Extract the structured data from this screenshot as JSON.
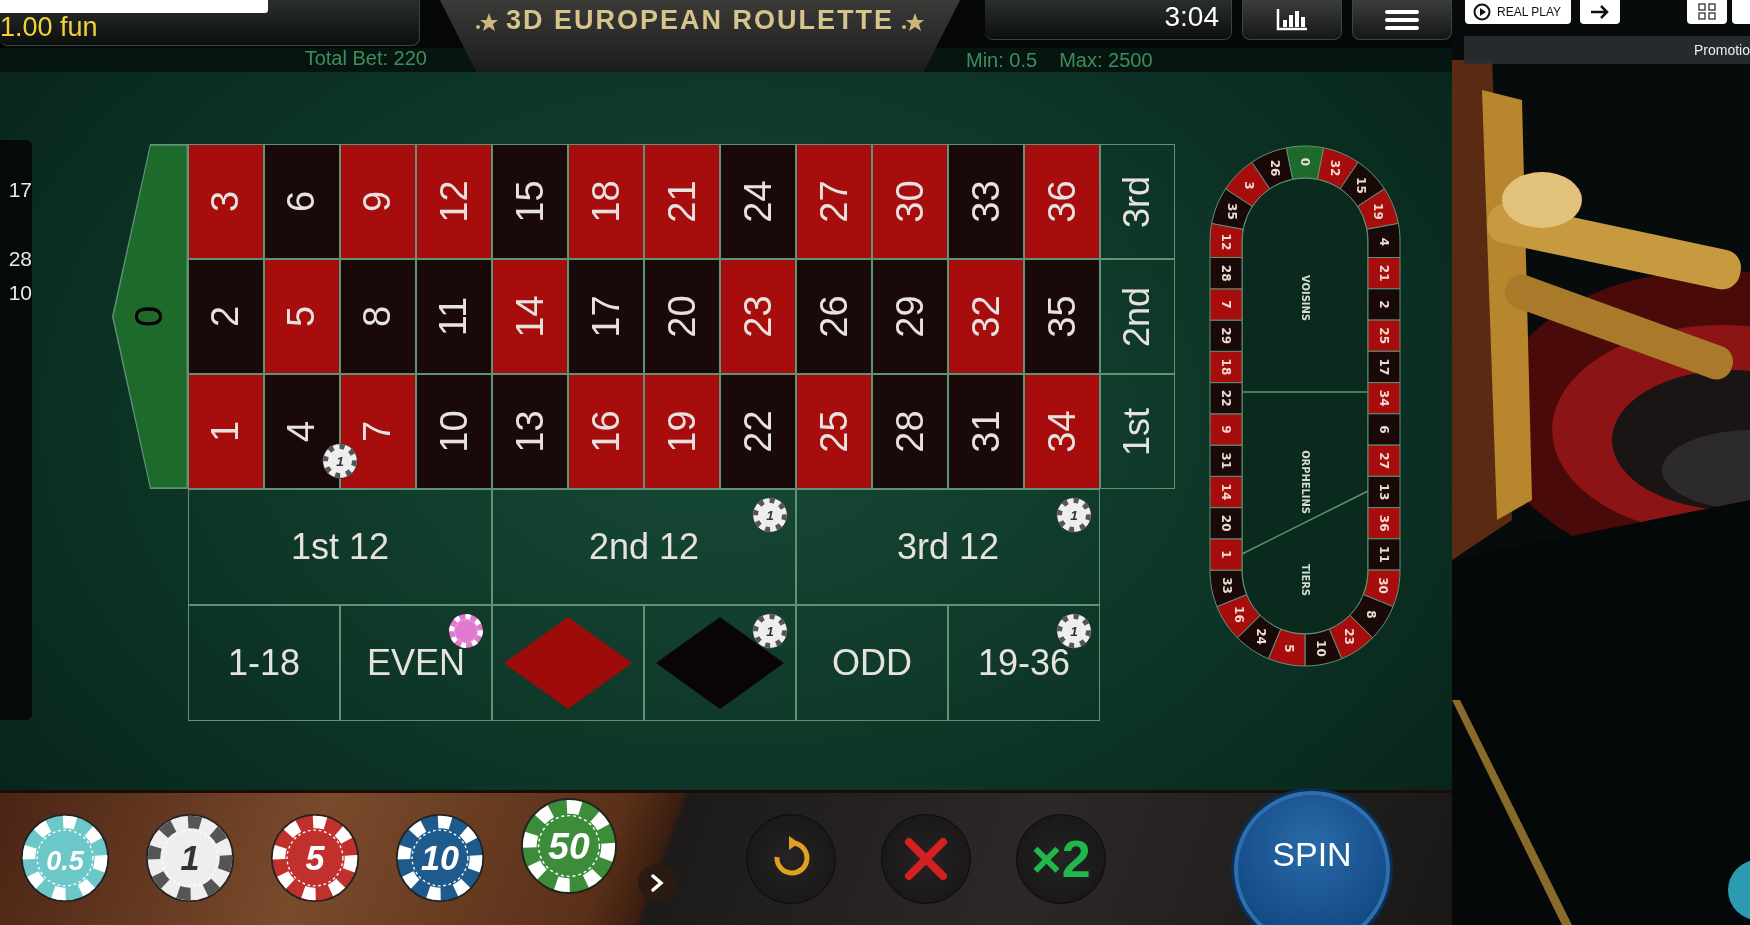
{
  "top_bar": {
    "balance": "1.00 fun",
    "title": "3D EUROPEAN ROULETTE",
    "timer": "3:04",
    "total_bet": "Total Bet: 220",
    "limits": [
      "Min: 0.5",
      "Max: 2500"
    ]
  },
  "history": [
    "17",
    "28",
    "10"
  ],
  "zero": {
    "label": "0",
    "color": "#1d6a2a"
  },
  "table": {
    "rows": [
      [
        {
          "label": "3",
          "color": "#a80d0d"
        },
        {
          "label": "6",
          "color": "#1a0909"
        },
        {
          "label": "9",
          "color": "#a80d0d"
        },
        {
          "label": "12",
          "color": "#a80d0d"
        },
        {
          "label": "15",
          "color": "#1a0909"
        },
        {
          "label": "18",
          "color": "#a80d0d"
        },
        {
          "label": "21",
          "color": "#a80d0d"
        },
        {
          "label": "24",
          "color": "#1a0909"
        },
        {
          "label": "27",
          "color": "#a80d0d"
        },
        {
          "label": "30",
          "color": "#a80d0d"
        },
        {
          "label": "33",
          "color": "#1a0909"
        },
        {
          "label": "36",
          "color": "#a80d0d"
        }
      ],
      [
        {
          "label": "2",
          "color": "#1a0909"
        },
        {
          "label": "5",
          "color": "#a80d0d"
        },
        {
          "label": "8",
          "color": "#1a0909"
        },
        {
          "label": "11",
          "color": "#1a0909"
        },
        {
          "label": "14",
          "color": "#a80d0d"
        },
        {
          "label": "17",
          "color": "#1a0909"
        },
        {
          "label": "20",
          "color": "#1a0909"
        },
        {
          "label": "23",
          "color": "#a80d0d"
        },
        {
          "label": "26",
          "color": "#1a0909"
        },
        {
          "label": "29",
          "color": "#1a0909"
        },
        {
          "label": "32",
          "color": "#a80d0d"
        },
        {
          "label": "35",
          "color": "#1a0909"
        }
      ],
      [
        {
          "label": "1",
          "color": "#a80d0d"
        },
        {
          "label": "4",
          "color": "#1a0909",
          "bet": {
            "color": "#eeeeee",
            "label": "1"
          }
        },
        {
          "label": "7",
          "color": "#a80d0d"
        },
        {
          "label": "10",
          "color": "#1a0909"
        },
        {
          "label": "13",
          "color": "#1a0909"
        },
        {
          "label": "16",
          "color": "#a80d0d"
        },
        {
          "label": "19",
          "color": "#a80d0d"
        },
        {
          "label": "22",
          "color": "#1a0909"
        },
        {
          "label": "25",
          "color": "#a80d0d"
        },
        {
          "label": "28",
          "color": "#1a0909"
        },
        {
          "label": "31",
          "color": "#1a0909"
        },
        {
          "label": "34",
          "color": "#a80d0d"
        }
      ]
    ],
    "column_bets": [
      "3rd",
      "2nd",
      "1st"
    ],
    "dozens": [
      {
        "label": "1st 12"
      },
      {
        "label": "2nd 12",
        "bet": {
          "color": "#eeeeee",
          "label": "1"
        }
      },
      {
        "label": "3rd 12",
        "bet": {
          "color": "#eeeeee",
          "label": "1"
        }
      }
    ],
    "outside": [
      {
        "kind": "text",
        "label": "1-18"
      },
      {
        "kind": "text",
        "label": "EVEN",
        "bet": {
          "color": "#e07ad0"
        }
      },
      {
        "kind": "diamond",
        "color": "#9e0b0b"
      },
      {
        "kind": "diamond",
        "color": "#0a0505",
        "bet": {
          "color": "#eeeeee",
          "label": "1"
        }
      },
      {
        "kind": "text",
        "label": "ODD"
      },
      {
        "kind": "text",
        "label": "19-36",
        "bet": {
          "color": "#eeeeee",
          "label": "1"
        }
      }
    ]
  },
  "racetrack": {
    "numbers": [
      {
        "label": "0",
        "color": "#1d6a2a"
      },
      {
        "label": "32",
        "color": "#a80d0d"
      },
      {
        "label": "15",
        "color": "#1a0909"
      },
      {
        "label": "19",
        "color": "#a80d0d"
      },
      {
        "label": "4",
        "color": "#1a0909"
      },
      {
        "label": "21",
        "color": "#a80d0d"
      },
      {
        "label": "2",
        "color": "#1a0909"
      },
      {
        "label": "25",
        "color": "#a80d0d"
      },
      {
        "label": "17",
        "color": "#1a0909"
      },
      {
        "label": "34",
        "color": "#a80d0d"
      },
      {
        "label": "6",
        "color": "#1a0909"
      },
      {
        "label": "27",
        "color": "#a80d0d"
      },
      {
        "label": "13",
        "color": "#1a0909"
      },
      {
        "label": "36",
        "color": "#a80d0d"
      },
      {
        "label": "11",
        "color": "#1a0909"
      },
      {
        "label": "30",
        "color": "#a80d0d"
      },
      {
        "label": "8",
        "color": "#1a0909"
      },
      {
        "label": "23",
        "color": "#a80d0d"
      },
      {
        "label": "10",
        "color": "#1a0909"
      },
      {
        "label": "5",
        "color": "#a80d0d"
      },
      {
        "label": "24",
        "color": "#1a0909"
      },
      {
        "label": "16",
        "color": "#a80d0d"
      },
      {
        "label": "33",
        "color": "#1a0909"
      },
      {
        "label": "1",
        "color": "#a80d0d"
      },
      {
        "label": "20",
        "color": "#1a0909"
      },
      {
        "label": "14",
        "color": "#a80d0d"
      },
      {
        "label": "31",
        "color": "#1a0909"
      },
      {
        "label": "9",
        "color": "#a80d0d"
      },
      {
        "label": "22",
        "color": "#1a0909"
      },
      {
        "label": "18",
        "color": "#a80d0d"
      },
      {
        "label": "29",
        "color": "#1a0909"
      },
      {
        "label": "7",
        "color": "#a80d0d"
      },
      {
        "label": "28",
        "color": "#1a0909"
      },
      {
        "label": "12",
        "color": "#a80d0d"
      },
      {
        "label": "35",
        "color": "#1a0909"
      },
      {
        "label": "3",
        "color": "#a80d0d"
      },
      {
        "label": "26",
        "color": "#1a0909"
      }
    ],
    "sections": [
      "VOISINS",
      "ORPHELINS",
      "TIERS"
    ]
  },
  "chips": [
    {
      "label": "0.5",
      "color": "#6cc8c8",
      "selected": false
    },
    {
      "label": "1",
      "color": "#eeeeee",
      "selected": false
    },
    {
      "label": "5",
      "color": "#c0302c",
      "selected": false
    },
    {
      "label": "10",
      "color": "#1f5a8c",
      "selected": false
    },
    {
      "label": "50",
      "color": "#3c8c3a",
      "selected": true
    }
  ],
  "actions": [
    {
      "kind": "undo"
    },
    {
      "kind": "clear"
    },
    {
      "kind": "double",
      "label": "×2"
    }
  ],
  "spin": "SPIN",
  "side": {
    "real_play": "REAL PLAY",
    "promotions": "Promotio"
  }
}
